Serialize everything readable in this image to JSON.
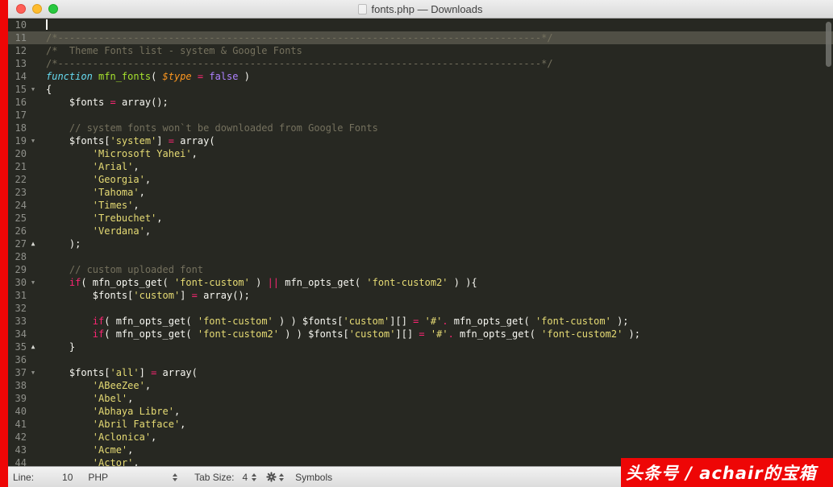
{
  "window": {
    "title": "fonts.php — Downloads",
    "traffic_lights": [
      {
        "name": "close",
        "color": "#ff5f57"
      },
      {
        "name": "minimize",
        "color": "#febc2e"
      },
      {
        "name": "zoom",
        "color": "#28c840"
      }
    ]
  },
  "icons": {
    "down": "▼",
    "up": "▲"
  },
  "editor": {
    "background": "#272822",
    "cursor_line": 10,
    "highlighted_line": 11,
    "line_highlight_color": "#504f45",
    "syntax_colors": {
      "plain": "#f8f8f2",
      "comment": "#75715e",
      "keyword": "#f92672",
      "string": "#e6db74",
      "storage": "#66d9ef",
      "function_name": "#a6e22e",
      "parameter": "#fd971f",
      "constant": "#ae81ff",
      "gutter": "#8f908a"
    },
    "lines": [
      {
        "n": 10,
        "fold": "",
        "seg": []
      },
      {
        "n": 11,
        "fold": "",
        "seg": [
          [
            "/*-----------------------------------------------------------------------------------*/",
            "c"
          ]
        ]
      },
      {
        "n": 12,
        "fold": "",
        "seg": [
          [
            "/*  Theme Fonts list - system & Google Fonts",
            "c"
          ]
        ]
      },
      {
        "n": 13,
        "fold": "",
        "seg": [
          [
            "/*-----------------------------------------------------------------------------------*/",
            "c"
          ]
        ]
      },
      {
        "n": 14,
        "fold": "",
        "seg": [
          [
            "function ",
            "t"
          ],
          [
            "mfn_fonts",
            "f"
          ],
          [
            "( ",
            "p"
          ],
          [
            "$type",
            "pa"
          ],
          [
            " ",
            "p"
          ],
          [
            "=",
            "k"
          ],
          [
            " ",
            "p"
          ],
          [
            "false",
            "n"
          ],
          [
            " )",
            "p"
          ]
        ]
      },
      {
        "n": 15,
        "fold": "down",
        "seg": [
          [
            "{",
            "p"
          ]
        ]
      },
      {
        "n": 16,
        "fold": "",
        "seg": [
          [
            "    $fonts ",
            "p"
          ],
          [
            "=",
            "k"
          ],
          [
            " array();",
            "p"
          ]
        ]
      },
      {
        "n": 17,
        "fold": "",
        "seg": []
      },
      {
        "n": 18,
        "fold": "",
        "seg": [
          [
            "    // system fonts won`t be downloaded from Google Fonts",
            "c"
          ]
        ]
      },
      {
        "n": 19,
        "fold": "down",
        "seg": [
          [
            "    $fonts[",
            "p"
          ],
          [
            "'system'",
            "s"
          ],
          [
            "] ",
            "p"
          ],
          [
            "=",
            "k"
          ],
          [
            " array(",
            "p"
          ]
        ]
      },
      {
        "n": 20,
        "fold": "",
        "seg": [
          [
            "        ",
            "p"
          ],
          [
            "'Microsoft Yahei'",
            "s"
          ],
          [
            ",",
            "p"
          ]
        ]
      },
      {
        "n": 21,
        "fold": "",
        "seg": [
          [
            "        ",
            "p"
          ],
          [
            "'Arial'",
            "s"
          ],
          [
            ",",
            "p"
          ]
        ]
      },
      {
        "n": 22,
        "fold": "",
        "seg": [
          [
            "        ",
            "p"
          ],
          [
            "'Georgia'",
            "s"
          ],
          [
            ",",
            "p"
          ]
        ]
      },
      {
        "n": 23,
        "fold": "",
        "seg": [
          [
            "        ",
            "p"
          ],
          [
            "'Tahoma'",
            "s"
          ],
          [
            ",",
            "p"
          ]
        ]
      },
      {
        "n": 24,
        "fold": "",
        "seg": [
          [
            "        ",
            "p"
          ],
          [
            "'Times'",
            "s"
          ],
          [
            ",",
            "p"
          ]
        ]
      },
      {
        "n": 25,
        "fold": "",
        "seg": [
          [
            "        ",
            "p"
          ],
          [
            "'Trebuchet'",
            "s"
          ],
          [
            ",",
            "p"
          ]
        ]
      },
      {
        "n": 26,
        "fold": "",
        "seg": [
          [
            "        ",
            "p"
          ],
          [
            "'Verdana'",
            "s"
          ],
          [
            ",",
            "p"
          ]
        ]
      },
      {
        "n": 27,
        "fold": "up",
        "seg": [
          [
            "    );",
            "p"
          ]
        ]
      },
      {
        "n": 28,
        "fold": "",
        "seg": []
      },
      {
        "n": 29,
        "fold": "",
        "seg": [
          [
            "    // custom uploaded font",
            "c"
          ]
        ]
      },
      {
        "n": 30,
        "fold": "down",
        "seg": [
          [
            "    ",
            "p"
          ],
          [
            "if",
            "k"
          ],
          [
            "( mfn_opts_get( ",
            "p"
          ],
          [
            "'font-custom'",
            "s"
          ],
          [
            " ) ",
            "p"
          ],
          [
            "||",
            "k"
          ],
          [
            " mfn_opts_get( ",
            "p"
          ],
          [
            "'font-custom2'",
            "s"
          ],
          [
            " ) ){",
            "p"
          ]
        ]
      },
      {
        "n": 31,
        "fold": "",
        "seg": [
          [
            "        $fonts[",
            "p"
          ],
          [
            "'custom'",
            "s"
          ],
          [
            "] ",
            "p"
          ],
          [
            "=",
            "k"
          ],
          [
            " array();",
            "p"
          ]
        ]
      },
      {
        "n": 32,
        "fold": "",
        "seg": []
      },
      {
        "n": 33,
        "fold": "",
        "seg": [
          [
            "        ",
            "p"
          ],
          [
            "if",
            "k"
          ],
          [
            "( mfn_opts_get( ",
            "p"
          ],
          [
            "'font-custom'",
            "s"
          ],
          [
            " ) ) $fonts[",
            "p"
          ],
          [
            "'custom'",
            "s"
          ],
          [
            "][] ",
            "p"
          ],
          [
            "=",
            "k"
          ],
          [
            " ",
            "p"
          ],
          [
            "'#'",
            "s"
          ],
          [
            ".",
            "k"
          ],
          [
            " mfn_opts_get( ",
            "p"
          ],
          [
            "'font-custom'",
            "s"
          ],
          [
            " );",
            "p"
          ]
        ]
      },
      {
        "n": 34,
        "fold": "",
        "seg": [
          [
            "        ",
            "p"
          ],
          [
            "if",
            "k"
          ],
          [
            "( mfn_opts_get( ",
            "p"
          ],
          [
            "'font-custom2'",
            "s"
          ],
          [
            " ) ) $fonts[",
            "p"
          ],
          [
            "'custom'",
            "s"
          ],
          [
            "][] ",
            "p"
          ],
          [
            "=",
            "k"
          ],
          [
            " ",
            "p"
          ],
          [
            "'#'",
            "s"
          ],
          [
            ".",
            "k"
          ],
          [
            " mfn_opts_get( ",
            "p"
          ],
          [
            "'font-custom2'",
            "s"
          ],
          [
            " );",
            "p"
          ]
        ]
      },
      {
        "n": 35,
        "fold": "up",
        "seg": [
          [
            "    }",
            "p"
          ]
        ]
      },
      {
        "n": 36,
        "fold": "",
        "seg": []
      },
      {
        "n": 37,
        "fold": "down",
        "seg": [
          [
            "    $fonts[",
            "p"
          ],
          [
            "'all'",
            "s"
          ],
          [
            "] ",
            "p"
          ],
          [
            "=",
            "k"
          ],
          [
            " array(",
            "p"
          ]
        ]
      },
      {
        "n": 38,
        "fold": "",
        "seg": [
          [
            "        ",
            "p"
          ],
          [
            "'ABeeZee'",
            "s"
          ],
          [
            ",",
            "p"
          ]
        ]
      },
      {
        "n": 39,
        "fold": "",
        "seg": [
          [
            "        ",
            "p"
          ],
          [
            "'Abel'",
            "s"
          ],
          [
            ",",
            "p"
          ]
        ]
      },
      {
        "n": 40,
        "fold": "",
        "seg": [
          [
            "        ",
            "p"
          ],
          [
            "'Abhaya Libre'",
            "s"
          ],
          [
            ",",
            "p"
          ]
        ]
      },
      {
        "n": 41,
        "fold": "",
        "seg": [
          [
            "        ",
            "p"
          ],
          [
            "'Abril Fatface'",
            "s"
          ],
          [
            ",",
            "p"
          ]
        ]
      },
      {
        "n": 42,
        "fold": "",
        "seg": [
          [
            "        ",
            "p"
          ],
          [
            "'Aclonica'",
            "s"
          ],
          [
            ",",
            "p"
          ]
        ]
      },
      {
        "n": 43,
        "fold": "",
        "seg": [
          [
            "        ",
            "p"
          ],
          [
            "'Acme'",
            "s"
          ],
          [
            ",",
            "p"
          ]
        ]
      },
      {
        "n": 44,
        "fold": "",
        "seg": [
          [
            "        ",
            "p"
          ],
          [
            "'Actor'",
            "s"
          ],
          [
            ",",
            "p"
          ]
        ]
      }
    ]
  },
  "status_bar": {
    "line_label": "Line:",
    "line_value": "10",
    "syntax": "PHP",
    "tab_size_label": "Tab Size:",
    "tab_size_value": "4",
    "symbols_label": "Symbols"
  },
  "watermark": {
    "text": "头条号 / achair的宝箱",
    "text_color": "#ffffff",
    "background": "#ee0606"
  }
}
